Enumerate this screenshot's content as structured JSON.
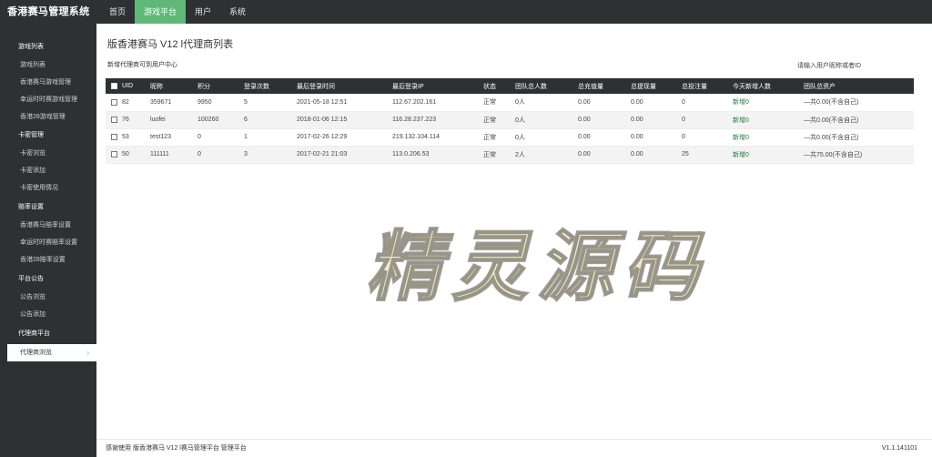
{
  "brand": {
    "title": "香港赛马管理系统"
  },
  "topnav": [
    "首页",
    "游戏平台",
    "用户",
    "系统"
  ],
  "sidebar": {
    "groups": [
      {
        "label": "游戏列表",
        "items": [
          "游戏列表",
          "香港赛马游戏管理",
          "幸运时时赛游戏管理",
          "香港28游戏管理"
        ]
      },
      {
        "label": "卡密管理",
        "items": [
          "卡密浏览",
          "卡密添加",
          "卡密使用情况"
        ]
      },
      {
        "label": "赔率设置",
        "items": [
          "香港赛马赔率设置",
          "幸运时时赛赔率设置",
          "香港28赔率设置"
        ]
      },
      {
        "label": "平台公告",
        "items": [
          "公告浏览",
          "公告添加"
        ]
      },
      {
        "label": "代理商平台",
        "items": [
          "代理商浏览"
        ]
      }
    ],
    "active_item": "代理商浏览"
  },
  "main": {
    "title": "版香港赛马 V12 l代理商列表",
    "agent_link": "新增代理商可到用户中心",
    "search_placeholder": "请输入用户昵称或者ID"
  },
  "table": {
    "headers": [
      "UID",
      "昵称",
      "积分",
      "登录次数",
      "最后登录时间",
      "最后登录IP",
      "状态",
      "团队总人数",
      "总充值量",
      "总提现量",
      "总投注量",
      "今天新增人数",
      "团队总资产"
    ],
    "rows": [
      [
        "82",
        "359671",
        "9950",
        "5",
        "2021-05-18 12:51",
        "112.67.202.161",
        "正常",
        "0人",
        "0.00",
        "0.00",
        "0",
        "新增0",
        "—共0.00(不含自己)"
      ],
      [
        "76",
        "luofei",
        "100260",
        "6",
        "2018-01-06 12:15",
        "116.28.237.223",
        "正常",
        "0人",
        "0.00",
        "0.00",
        "0",
        "新增0",
        "—共0.00(不含自己)"
      ],
      [
        "53",
        "test123",
        "0",
        "1",
        "2017-02-26 12:29",
        "219.132.104.114",
        "正常",
        "0人",
        "0.00",
        "0.00",
        "0",
        "新增0",
        "—共0.00(不含自己)"
      ],
      [
        "50",
        "111111",
        "0",
        "3",
        "2017-02-21 21:03",
        "113.0.206.53",
        "正常",
        "2人",
        "0.00",
        "0.00",
        "25",
        "新增0",
        "—共75.00(不含自己)"
      ]
    ]
  },
  "watermark": "精灵源码",
  "footer": {
    "text": "感谢使用 版香港赛马 V12 l赛马管理平台 管理平台",
    "version": "V1.1.141101"
  },
  "colors": {
    "topbar": "#2f3033",
    "active_tab": "#5fb878",
    "link": "#1b7a3a"
  },
  "icons": {
    "sidebar_active": "chevron-right-icon",
    "row_select": "checkbox-icon"
  }
}
